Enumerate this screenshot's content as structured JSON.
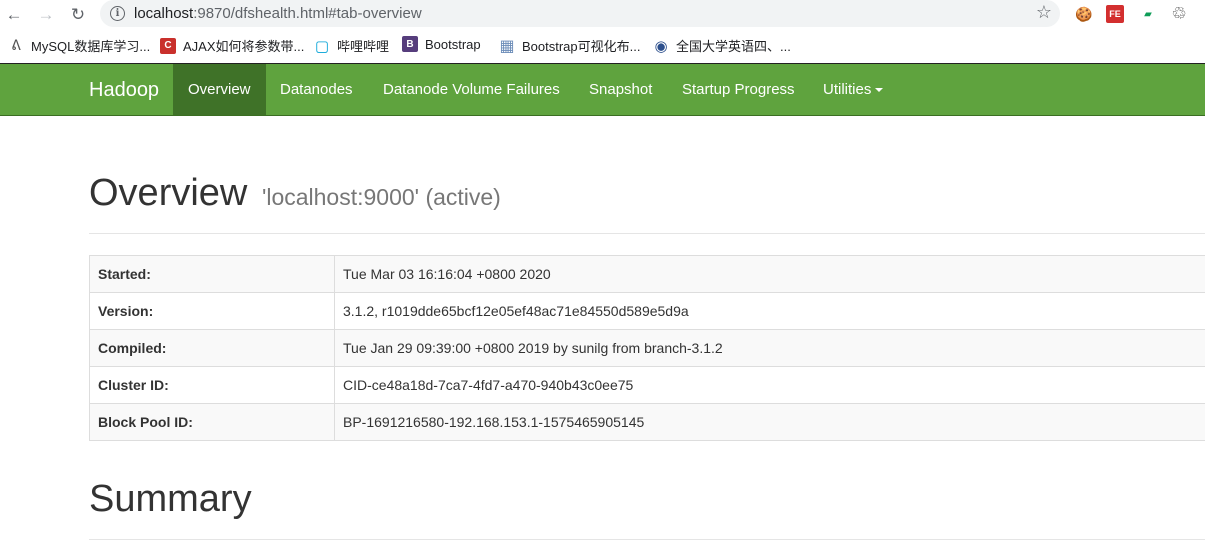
{
  "browser": {
    "url_host": "localhost",
    "url_rest": ":9870/dfshealth.html#tab-overview",
    "back_glyph": "←",
    "forward_glyph": "→",
    "reload_glyph": "↻",
    "info_glyph": "i",
    "star_glyph": "☆",
    "extensions": [
      {
        "icon": "cookie-icon",
        "glyph": "🍪"
      },
      {
        "icon": "fe-icon",
        "glyph": "FE"
      },
      {
        "icon": "green-extension-icon",
        "glyph": "▰"
      },
      {
        "icon": "recycle-icon",
        "glyph": "♲"
      }
    ]
  },
  "bookmarks": [
    {
      "label": "MySQL数据库学习...",
      "icon": "mysql-icon",
      "glyph": "ᕕ",
      "color": "#555555"
    },
    {
      "label": "AJAX如何将参数带...",
      "icon": "csdn-icon",
      "glyph": "C",
      "color": "#c9302c"
    },
    {
      "label": "哔哩哔哩",
      "icon": "bilibili-icon",
      "glyph": "▢",
      "color": "#00a1d6"
    },
    {
      "label": "Bootstrap",
      "icon": "bootstrap-icon",
      "glyph": "B",
      "color": "#563d7c"
    },
    {
      "label": "Bootstrap可视化布...",
      "icon": "grid-icon",
      "glyph": "▦",
      "color": "#6b8cb8"
    },
    {
      "label": "全国大学英语四、...",
      "icon": "cet-icon",
      "glyph": "◉",
      "color": "#2c4f8c"
    }
  ],
  "navbar": {
    "brand": "Hadoop",
    "items": [
      {
        "label": "Overview",
        "active": true
      },
      {
        "label": "Datanodes"
      },
      {
        "label": "Datanode Volume Failures"
      },
      {
        "label": "Snapshot"
      },
      {
        "label": "Startup Progress"
      },
      {
        "label": "Utilities",
        "dropdown": true
      }
    ],
    "color": "#5fa33e",
    "active_color": "#3f7228"
  },
  "overview": {
    "title": "Overview",
    "subtitle": "'localhost:9000' (active)",
    "rows": [
      {
        "key": "Started:",
        "value": "Tue Mar 03 16:16:04 +0800 2020"
      },
      {
        "key": "Version:",
        "value": "3.1.2, r1019dde65bcf12e05ef48ac71e84550d589e5d9a"
      },
      {
        "key": "Compiled:",
        "value": "Tue Jan 29 09:39:00 +0800 2019 by sunilg from branch-3.1.2"
      },
      {
        "key": "Cluster ID:",
        "value": "CID-ce48a18d-7ca7-4fd7-a470-940b43c0ee75"
      },
      {
        "key": "Block Pool ID:",
        "value": "BP-1691216580-192.168.153.1-1575465905145"
      }
    ]
  },
  "summary": {
    "title": "Summary"
  }
}
